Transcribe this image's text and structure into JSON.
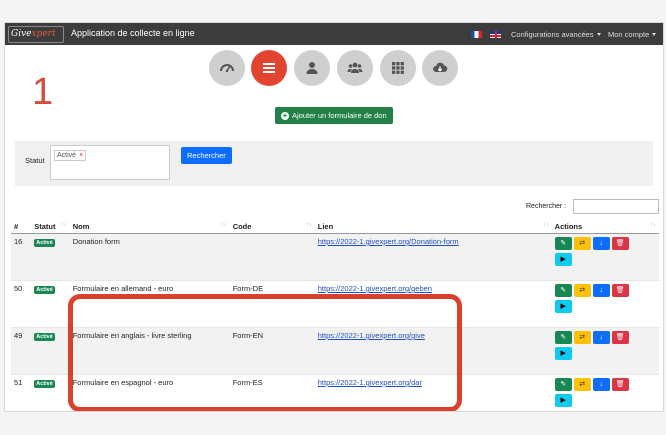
{
  "header": {
    "logo_text": "Give",
    "logo_accent": "xpert",
    "app_title": "Application de collecte en ligne",
    "advanced_settings": "Configurations avancées",
    "account": "Mon compte"
  },
  "step_number": "1",
  "nav_icons": [
    "dashboard-icon",
    "list-icon",
    "user-icon",
    "users-icon",
    "grid-icon",
    "cloud-download-icon"
  ],
  "add_button": "Ajouter un formulaire de don",
  "filter": {
    "statut_label": "Statut",
    "tag": "Activé",
    "tag_remove": "×",
    "search_button": "Rechercher"
  },
  "table_search_label": "Rechercher :",
  "columns": {
    "id": "#",
    "statut": "Statut",
    "nom": "Nom",
    "code": "Code",
    "lien": "Lien",
    "actions": "Actions"
  },
  "rows": [
    {
      "id": "16",
      "statut": "Activé",
      "nom": "Donation form",
      "code": "",
      "lien": "https://2022-1.givexpert.org/Donation-form"
    },
    {
      "id": "50",
      "statut": "Activé",
      "nom": "Formulaire en allemand - euro",
      "code": "Form-DE",
      "lien": "https://2022-1.givexpert.org/geben"
    },
    {
      "id": "49",
      "statut": "Activé",
      "nom": "Formulaire en anglais - livre sterling",
      "code": "Form-EN",
      "lien": "https://2022-1.givexpert.org/give"
    },
    {
      "id": "51",
      "statut": "Activé",
      "nom": "Formulaire en espagnol - euro",
      "code": "Form-ES",
      "lien": "https://2022-1.givexpert.org/dar"
    }
  ],
  "colors": {
    "accent_red": "#e2452f",
    "highlight": "#d9402e",
    "badge_green": "#198754",
    "add_green": "#238148",
    "primary_blue": "#0d6efd"
  }
}
